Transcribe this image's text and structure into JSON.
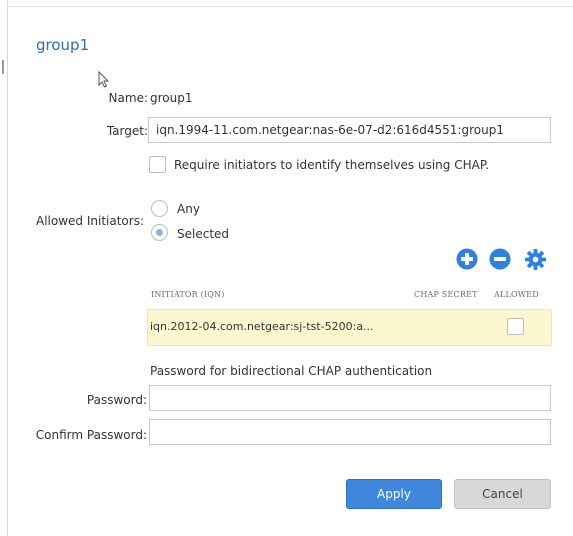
{
  "dialog": {
    "title": "group1"
  },
  "form": {
    "name_label": "Name:",
    "name_value": "group1",
    "target_label": "Target:",
    "target_value": "iqn.1994-11.com.netgear:nas-6e-07-d2:616d4551:group1",
    "chap_require_label": "Require initiators to identify themselves using CHAP.",
    "allowed_initiators_label": "Allowed Initiators:",
    "option_any": "Any",
    "option_selected": "Selected",
    "selected_option": "Selected"
  },
  "initiators": {
    "columns": [
      "INITIATOR (IQN)",
      "CHAP SECRET",
      "ALLOWED"
    ],
    "rows": [
      {
        "iqn": "iqn.2012-04.com.netgear:sj-tst-5200:a...",
        "chap_secret": "",
        "allowed": false
      }
    ],
    "toolbar_icons": [
      "add-icon",
      "remove-icon",
      "gear-icon"
    ]
  },
  "bidirectional": {
    "heading": "Password for bidirectional CHAP authentication",
    "password_label": "Password:",
    "password_value": "",
    "confirm_label": "Confirm Password:",
    "confirm_value": ""
  },
  "buttons": {
    "apply": "Apply",
    "cancel": "Cancel"
  },
  "colors": {
    "accent": "#3e87dd",
    "title": "#2b6cb0",
    "row_highlight": "#fbf7cf"
  }
}
